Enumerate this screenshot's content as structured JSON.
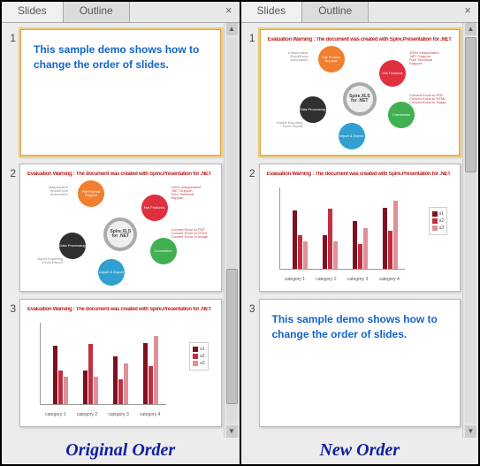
{
  "tabs": {
    "slides": "Slides",
    "outline": "Outline"
  },
  "demo_text": "This sample demo shows how to change the order of slides.",
  "watermark": "Evaluation Warning : The document was created with Spire.Presentation for .NET",
  "diagram": {
    "center": "Spire.XLS for .NET",
    "nodes": [
      "File Format Support",
      "Hot Features",
      "Conversion",
      "Import & Export",
      "Data Processing"
    ]
  },
  "chart_data": {
    "type": "bar",
    "categories": [
      "category 1",
      "category 2",
      "category 3",
      "category 4"
    ],
    "series": [
      {
        "name": "s1",
        "values": [
          4.3,
          2.5,
          3.5,
          4.5
        ]
      },
      {
        "name": "s2",
        "values": [
          2.5,
          4.4,
          1.8,
          2.8
        ]
      },
      {
        "name": "s3",
        "values": [
          2.0,
          2.0,
          3.0,
          5.0
        ]
      }
    ],
    "ylim": [
      0,
      5
    ],
    "ylabel": "",
    "xlabel": ""
  },
  "legend": [
    "s1",
    "s2",
    "s3"
  ],
  "captions": {
    "left": "Original Order",
    "right": "New Order"
  },
  "panels": {
    "left": {
      "slides": [
        "text",
        "diagram",
        "chart"
      ],
      "selected": 1,
      "scroll_pos": 0.75
    },
    "right": {
      "slides": [
        "diagram",
        "chart",
        "text"
      ],
      "selected": 1,
      "scroll_pos": 0.0
    }
  }
}
